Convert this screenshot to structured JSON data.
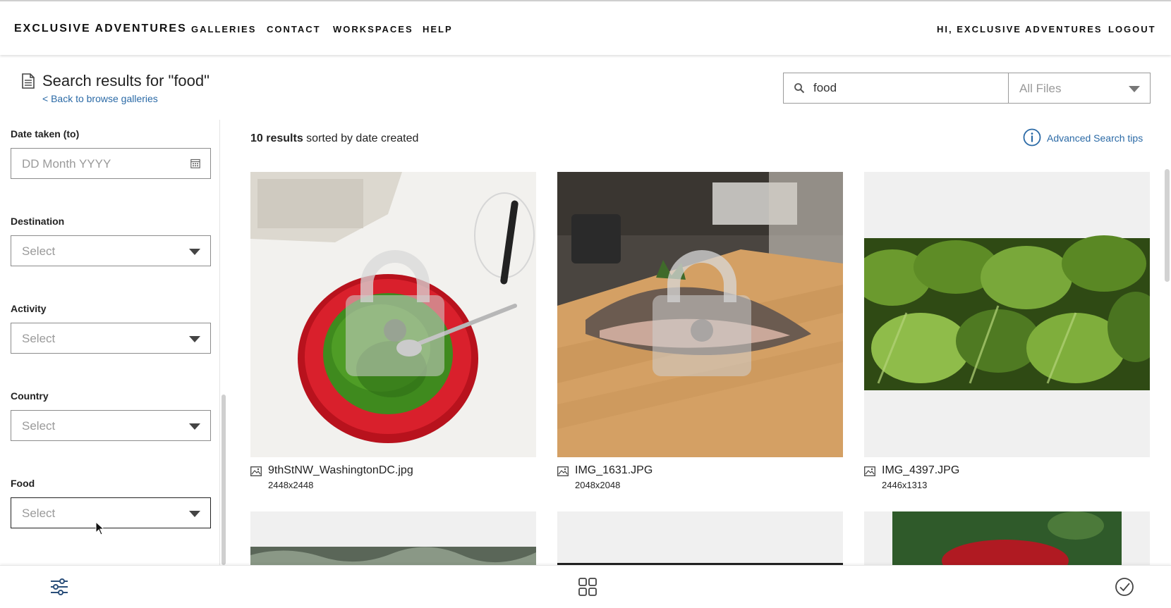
{
  "header": {
    "brand": "EXCLUSIVE ADVENTURES",
    "nav": [
      "GALLERIES",
      "CONTACT",
      "WORKSPACES",
      "HELP"
    ],
    "greeting": "HI, EXCLUSIVE ADVENTURES",
    "logout": "LOGOUT"
  },
  "page": {
    "title": "Search results for \"food\"",
    "back_link": "< Back to browse galleries"
  },
  "search": {
    "value": "food",
    "file_type_selected": "All Files"
  },
  "filters": [
    {
      "label": "Date taken (to)",
      "placeholder": "DD Month YYYY",
      "kind": "date"
    },
    {
      "label": "Destination",
      "placeholder": "Select",
      "kind": "select"
    },
    {
      "label": "Activity",
      "placeholder": "Select",
      "kind": "select"
    },
    {
      "label": "Country",
      "placeholder": "Select",
      "kind": "select"
    },
    {
      "label": "Food",
      "placeholder": "Select",
      "kind": "select"
    }
  ],
  "results": {
    "count": "10 results",
    "sort_text": "sorted by date created",
    "advanced_tips": "Advanced Search tips",
    "items": [
      {
        "name": "9thStNW_WashingtonDC.jpg",
        "dims": "2448x2448",
        "locked": true
      },
      {
        "name": "IMG_1631.JPG",
        "dims": "2048x2048",
        "locked": true
      },
      {
        "name": "IMG_4397.JPG",
        "dims": "2446x1313",
        "locked": false
      }
    ]
  },
  "colors": {
    "link": "#2b6aa6",
    "bowl_red": "#d9202c",
    "peas_green": "#3f8a1e",
    "wood": "#d4a064",
    "leaf_green": "#4f7a22"
  },
  "icons": {
    "filters_toggle": "sliders-icon",
    "grid_view": "grid-icon",
    "select_mode": "check-circle-icon"
  }
}
